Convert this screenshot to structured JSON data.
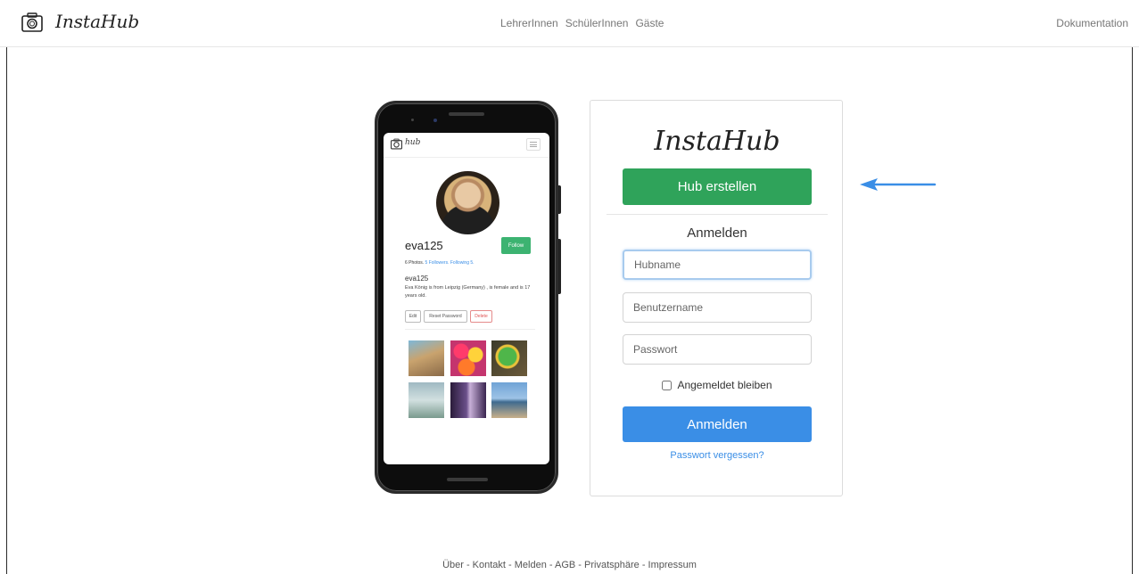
{
  "header": {
    "brand": "InstaHub",
    "nav": [
      "LehrerInnen",
      "SchülerInnen",
      "Gäste"
    ],
    "docs": "Dokumentation"
  },
  "phone": {
    "app_brand": "hub",
    "username": "eva125",
    "follow_label": "Follow",
    "stats_photos": "6 Photos.",
    "stats_followers": "5 Followers.",
    "stats_following": "Following 5.",
    "bio_name": "eva125",
    "bio_text": "Eva König is from Leipzig (Germany) , is female and is 17 years old.",
    "actions": [
      "Edit",
      "Reset Password",
      "Delete"
    ]
  },
  "login": {
    "logo": "InstaHub",
    "create_label": "Hub erstellen",
    "title": "Anmelden",
    "hubname_placeholder": "Hubname",
    "username_placeholder": "Benutzername",
    "password_placeholder": "Passwort",
    "remember_label": "Angemeldet bleiben",
    "submit_label": "Anmelden",
    "forgot_label": "Passwort vergessen?"
  },
  "footer": {
    "links": "Über - Kontakt - Melden - AGB - Privatsphäre - Impressum"
  },
  "colors": {
    "create_button": "#2fa35a",
    "login_button": "#3a8ee6",
    "arrow": "#3a8ee6"
  }
}
